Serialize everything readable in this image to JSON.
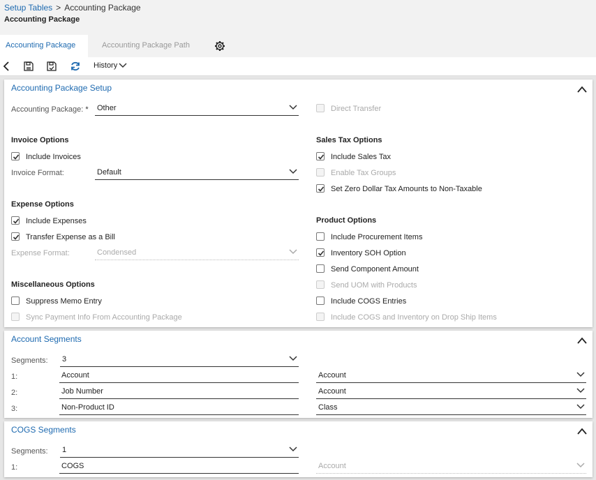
{
  "breadcrumb": {
    "parent": "Setup Tables",
    "separator": ">",
    "current": "Accounting Package"
  },
  "page_title": "Accounting Package",
  "tabs": [
    {
      "label": "Accounting Package",
      "active": true
    },
    {
      "label": "Accounting Package Path",
      "active": false
    }
  ],
  "toolbar": {
    "history_label": "History"
  },
  "setup": {
    "title": "Accounting Package Setup",
    "package_label": "Accounting Package:",
    "required_mark": "*",
    "package_value": "Other",
    "direct_transfer": {
      "label": "Direct Transfer",
      "checked": false,
      "disabled": true
    },
    "invoice": {
      "title": "Invoice Options",
      "include_invoices": {
        "label": "Include Invoices",
        "checked": true,
        "disabled": false
      },
      "format_label": "Invoice Format:",
      "format_value": "Default"
    },
    "sales_tax": {
      "title": "Sales Tax Options",
      "include_sales_tax": {
        "label": "Include Sales Tax",
        "checked": true,
        "disabled": false
      },
      "enable_tax_groups": {
        "label": "Enable Tax Groups",
        "checked": false,
        "disabled": true
      },
      "zero_dollar": {
        "label": "Set Zero Dollar Tax Amounts to Non-Taxable",
        "checked": true,
        "disabled": false
      }
    },
    "expense": {
      "title": "Expense Options",
      "include_expenses": {
        "label": "Include Expenses",
        "checked": true,
        "disabled": false
      },
      "transfer_bill": {
        "label": "Transfer Expense as a Bill",
        "checked": true,
        "disabled": false
      },
      "format_label": "Expense Format:",
      "format_value": "Condensed"
    },
    "product": {
      "title": "Product Options",
      "procurement": {
        "label": "Include Procurement Items",
        "checked": false,
        "disabled": false
      },
      "soh": {
        "label": "Inventory SOH Option",
        "checked": true,
        "disabled": false
      },
      "component": {
        "label": "Send Component Amount",
        "checked": false,
        "disabled": false
      },
      "uom": {
        "label": "Send UOM with Products",
        "checked": false,
        "disabled": true
      },
      "cogs": {
        "label": "Include COGS Entries",
        "checked": false,
        "disabled": false
      },
      "cogs_drop": {
        "label": "Include COGS and Inventory on Drop Ship Items",
        "checked": false,
        "disabled": true
      }
    },
    "misc": {
      "title": "Miscellaneous Options",
      "suppress_memo": {
        "label": "Suppress Memo Entry",
        "checked": false,
        "disabled": false
      },
      "sync_payment": {
        "label": "Sync Payment Info From Accounting Package",
        "checked": false,
        "disabled": true
      }
    }
  },
  "account_segments": {
    "title": "Account Segments",
    "segments_label": "Segments:",
    "segments_value": "3",
    "rows": [
      {
        "num": "1:",
        "name": "Account",
        "type": "Account"
      },
      {
        "num": "2:",
        "name": "Job Number",
        "type": "Account"
      },
      {
        "num": "3:",
        "name": "Non-Product ID",
        "type": "Class"
      }
    ]
  },
  "cogs_segments": {
    "title": "COGS Segments",
    "segments_label": "Segments:",
    "segments_value": "1",
    "rows": [
      {
        "num": "1:",
        "name": "COGS",
        "type": "Account"
      }
    ]
  },
  "colors": {
    "link": "#1e6ab0",
    "accent": "#1e6ab0",
    "text": "#222222",
    "disabled": "#aaaaaa"
  }
}
